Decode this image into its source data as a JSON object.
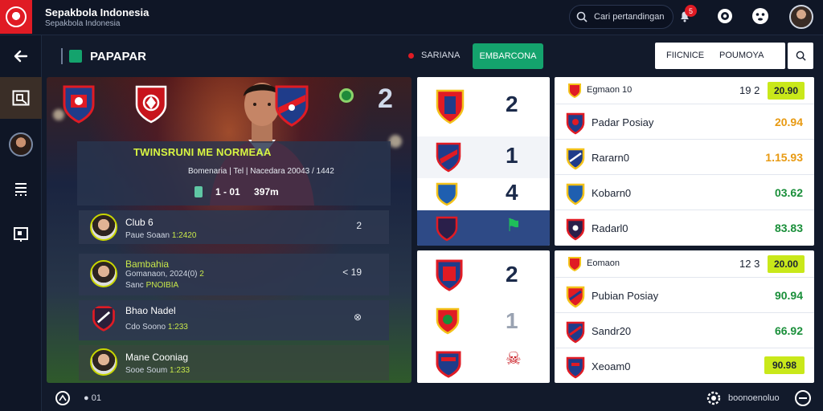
{
  "app": {
    "title": "Sepakbola Indonesia",
    "subtitle": "Sepakbola Indonesia"
  },
  "header": {
    "search_placeholder": "Cari pertandingan",
    "notification_count": "5",
    "icons": [
      "search-icon",
      "bell-icon",
      "settings-icon",
      "emoji-icon",
      "avatar"
    ]
  },
  "sidebar": {
    "items": [
      {
        "name": "back",
        "icon": "arrow-left-icon"
      },
      {
        "name": "pitch",
        "icon": "pitch-icon"
      },
      {
        "name": "profile",
        "icon": "avatar"
      },
      {
        "name": "stats",
        "icon": "list-icon"
      },
      {
        "name": "board",
        "icon": "board-icon"
      }
    ]
  },
  "section": {
    "title": "PAPAPAR",
    "live_label": "SARIANA",
    "action_label": "EMBARCONA",
    "filter_a": "FIICNICE",
    "filter_b": "POUMOYA"
  },
  "hero": {
    "big_number": "2",
    "match_title": "TWINSRUNI ME NORMEAA",
    "match_subtitle": "Bomenaria | Tel | Nacedara 20043 / 1442",
    "score": "1 - 01 ",
    "score_extra": "397m"
  },
  "players": [
    {
      "name": "Club 6",
      "meta_label": "Paue Soaan",
      "meta_value": "1:2420",
      "right": "2"
    },
    {
      "name": "Bambahia",
      "meta_label": "Gomanaon, 2024(0)",
      "meta_value": "2",
      "meta2_label": "Sanc",
      "meta2_value": "PNOIBIA",
      "right": "< 19"
    },
    {
      "name": "Bhao Nadel",
      "meta_label": "Cdo Soono",
      "meta_value": "1:233",
      "right": "⊗"
    },
    {
      "name": "Mane Cooniag",
      "meta_label": "Sooe Soum",
      "meta_value": "1:233",
      "right": ""
    }
  ],
  "mid_panel_top": [
    {
      "crest": "crest-red-blue",
      "num": "2"
    },
    {
      "crest": "crest-blue-red",
      "num": "1"
    },
    {
      "crest": "crest-blue-yellow",
      "num": "4"
    },
    {
      "crest": "crest-navy",
      "num": "⚑"
    }
  ],
  "mid_panel_bottom": [
    {
      "crest": "crest-red-navy",
      "num": "2"
    },
    {
      "crest": "crest-red-yellow",
      "num": "1"
    },
    {
      "crest": "crest-red-blue-2",
      "num": "☠"
    }
  ],
  "right_panel_top": {
    "header": {
      "name": "Egmaon 10",
      "count": "19 2",
      "pill": "20.90"
    },
    "rows": [
      {
        "name": "Padar Posiay",
        "value": "20.94",
        "tone": "orange"
      },
      {
        "name": "Rararn0",
        "value": "1.15.93",
        "tone": "orange"
      },
      {
        "name": "Kobarn0",
        "value": "03.62",
        "tone": "green"
      },
      {
        "name": "Radarl0",
        "value": "83.83",
        "tone": "green"
      }
    ]
  },
  "right_panel_bottom": {
    "header": {
      "name": "Eomaon",
      "count": "12 3",
      "pill": "20.00"
    },
    "rows": [
      {
        "name": "Pubian Posiay",
        "value": "90.94",
        "tone": "green"
      },
      {
        "name": "Sandr20",
        "value": "66.92",
        "tone": "green"
      },
      {
        "name": "Xeoam0",
        "value": "90.98",
        "tone": "pill"
      }
    ]
  },
  "footer": {
    "left_label": "● 01",
    "right_label": "boonoenoluo"
  },
  "colors": {
    "accent_red": "#e01b24",
    "accent_green": "#14a36d",
    "lime": "#c9e81a",
    "navy": "#121a2b"
  }
}
